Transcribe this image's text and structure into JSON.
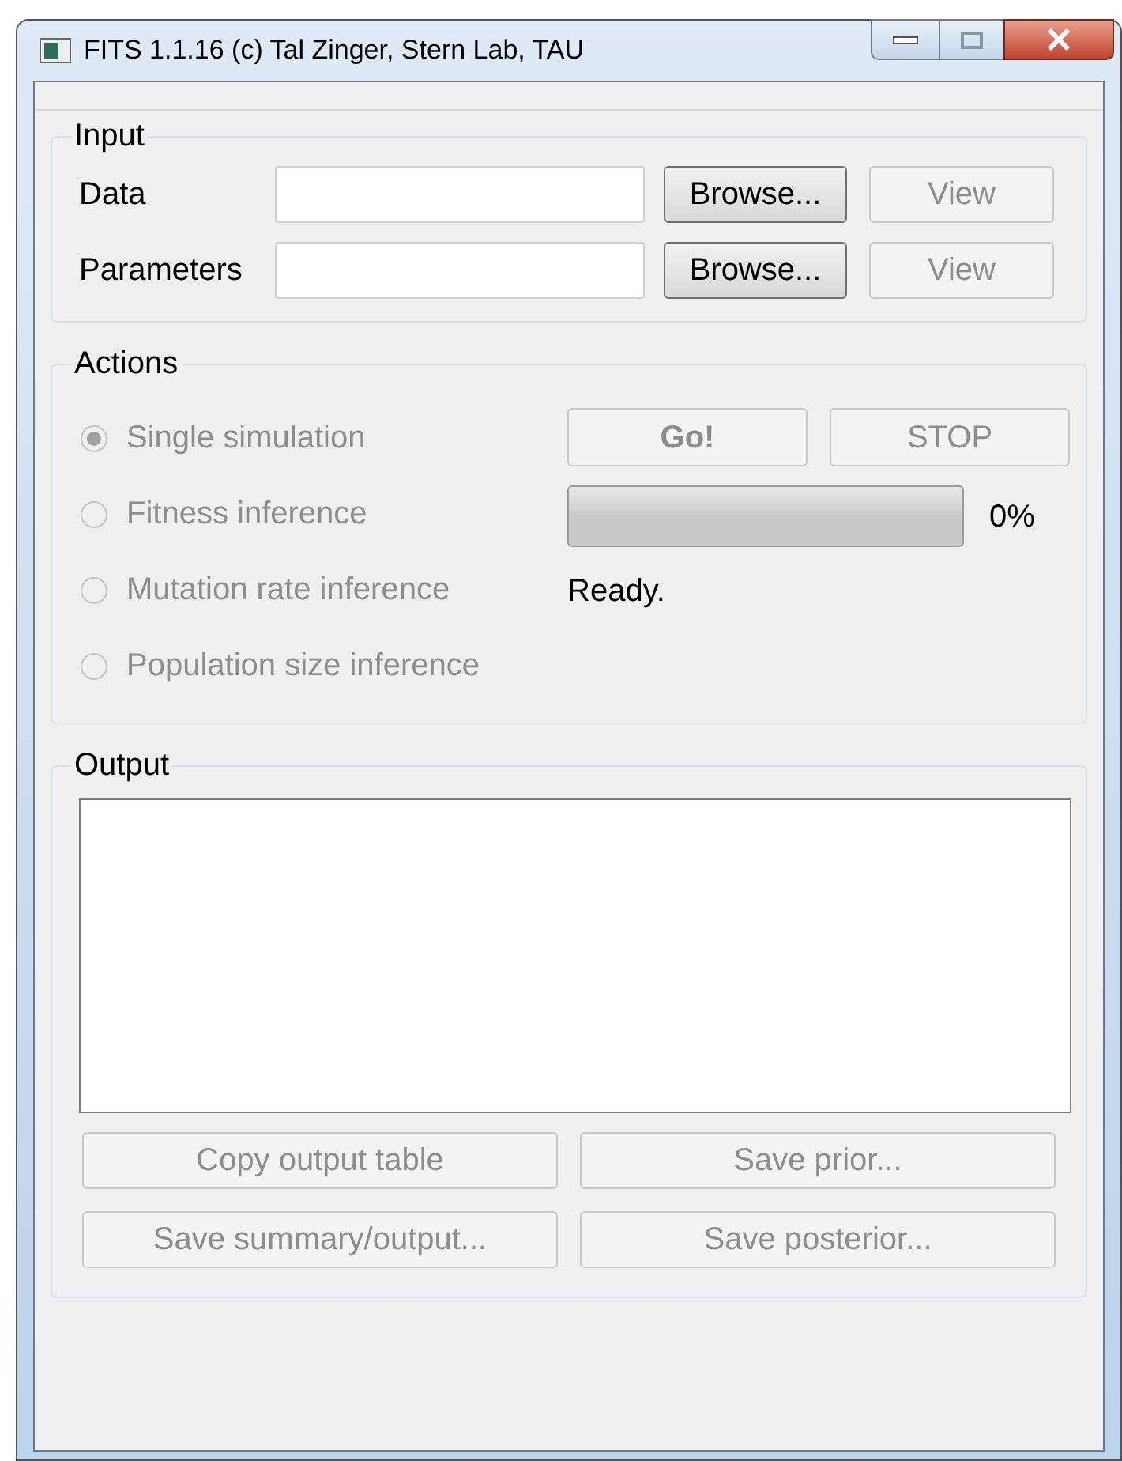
{
  "window": {
    "title": "FITS 1.1.16 (c) Tal Zinger, Stern Lab, TAU"
  },
  "input": {
    "title": "Input",
    "rows": [
      {
        "label": "Data",
        "browse": {
          "label": "Browse...",
          "disabled": false
        },
        "view": {
          "label": "View",
          "disabled": true
        }
      },
      {
        "label": "Parameters",
        "browse": {
          "label": "Browse...",
          "disabled": false
        },
        "view": {
          "label": "View",
          "disabled": true
        }
      }
    ]
  },
  "actions": {
    "title": "Actions",
    "options": [
      {
        "label": "Single simulation",
        "selected": true,
        "disabled": true
      },
      {
        "label": "Fitness inference",
        "selected": false,
        "disabled": true
      },
      {
        "label": "Mutation rate inference",
        "selected": false,
        "disabled": true
      },
      {
        "label": "Population size inference",
        "selected": false,
        "disabled": true
      }
    ],
    "go": {
      "label": "Go!",
      "disabled": true
    },
    "stop": {
      "label": "STOP",
      "disabled": true
    },
    "progress": {
      "level": 0,
      "reading": "0%"
    },
    "status": "Ready."
  },
  "output": {
    "title": "Output",
    "buttons": [
      {
        "label": "Copy output table",
        "disabled": true
      },
      {
        "label": "Save prior...",
        "disabled": true
      },
      {
        "label": "Save summary/output...",
        "disabled": true
      },
      {
        "label": "Save posterior...",
        "disabled": true
      }
    ]
  }
}
